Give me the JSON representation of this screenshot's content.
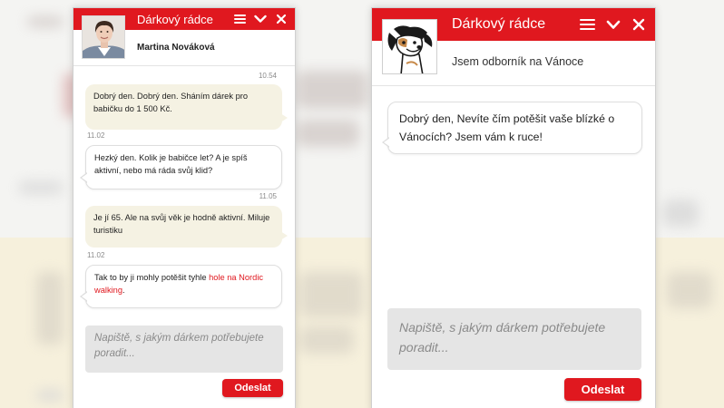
{
  "colors": {
    "brand_red": "#e0181f",
    "user_bubble": "#f5f2e3",
    "bot_bubble": "#ffffff",
    "input_bg": "#e5e5e5"
  },
  "left_widget": {
    "title": "Dárkový rádce",
    "agent_name": "Martina Nováková",
    "icons": [
      "menu-icon",
      "chevron-down-icon",
      "close-icon"
    ],
    "messages": [
      {
        "time": "10.54",
        "from": "user",
        "text": "Dobrý den. Dobrý den. Sháním dárek pro babičku do 1 500 Kč."
      },
      {
        "time": "11.02",
        "from": "agent",
        "text": "Hezký den. Kolik je babičce let? A je spíš aktivní, nebo má ráda svůj klid?"
      },
      {
        "time": "11.05",
        "from": "user",
        "text": "Je jí 65. Ale na svůj věk je hodně aktivní. Miluje turistiku"
      },
      {
        "time": "11.02",
        "from": "agent",
        "text_before": "Tak to by ji mohly potěšit tyhle ",
        "link": "hole na Nordic walking",
        "text_after": "."
      }
    ],
    "input_placeholder": "Napiště, s jakým dárkem potřebujete poradit...",
    "send_label": "Odeslat"
  },
  "right_widget": {
    "title": "Dárkový rádce",
    "agent_name": "Jsem odborník na Vánoce",
    "icons": [
      "menu-icon",
      "chevron-down-icon",
      "close-icon"
    ],
    "messages": [
      {
        "from": "agent",
        "text": "Dobrý den, Nevíte čím potěšit vaše blízké o Vánocích? Jsem vám k ruce!"
      }
    ],
    "input_placeholder": "Napiště, s jakým dárkem potřebujete poradit...",
    "send_label": "Odeslat"
  }
}
